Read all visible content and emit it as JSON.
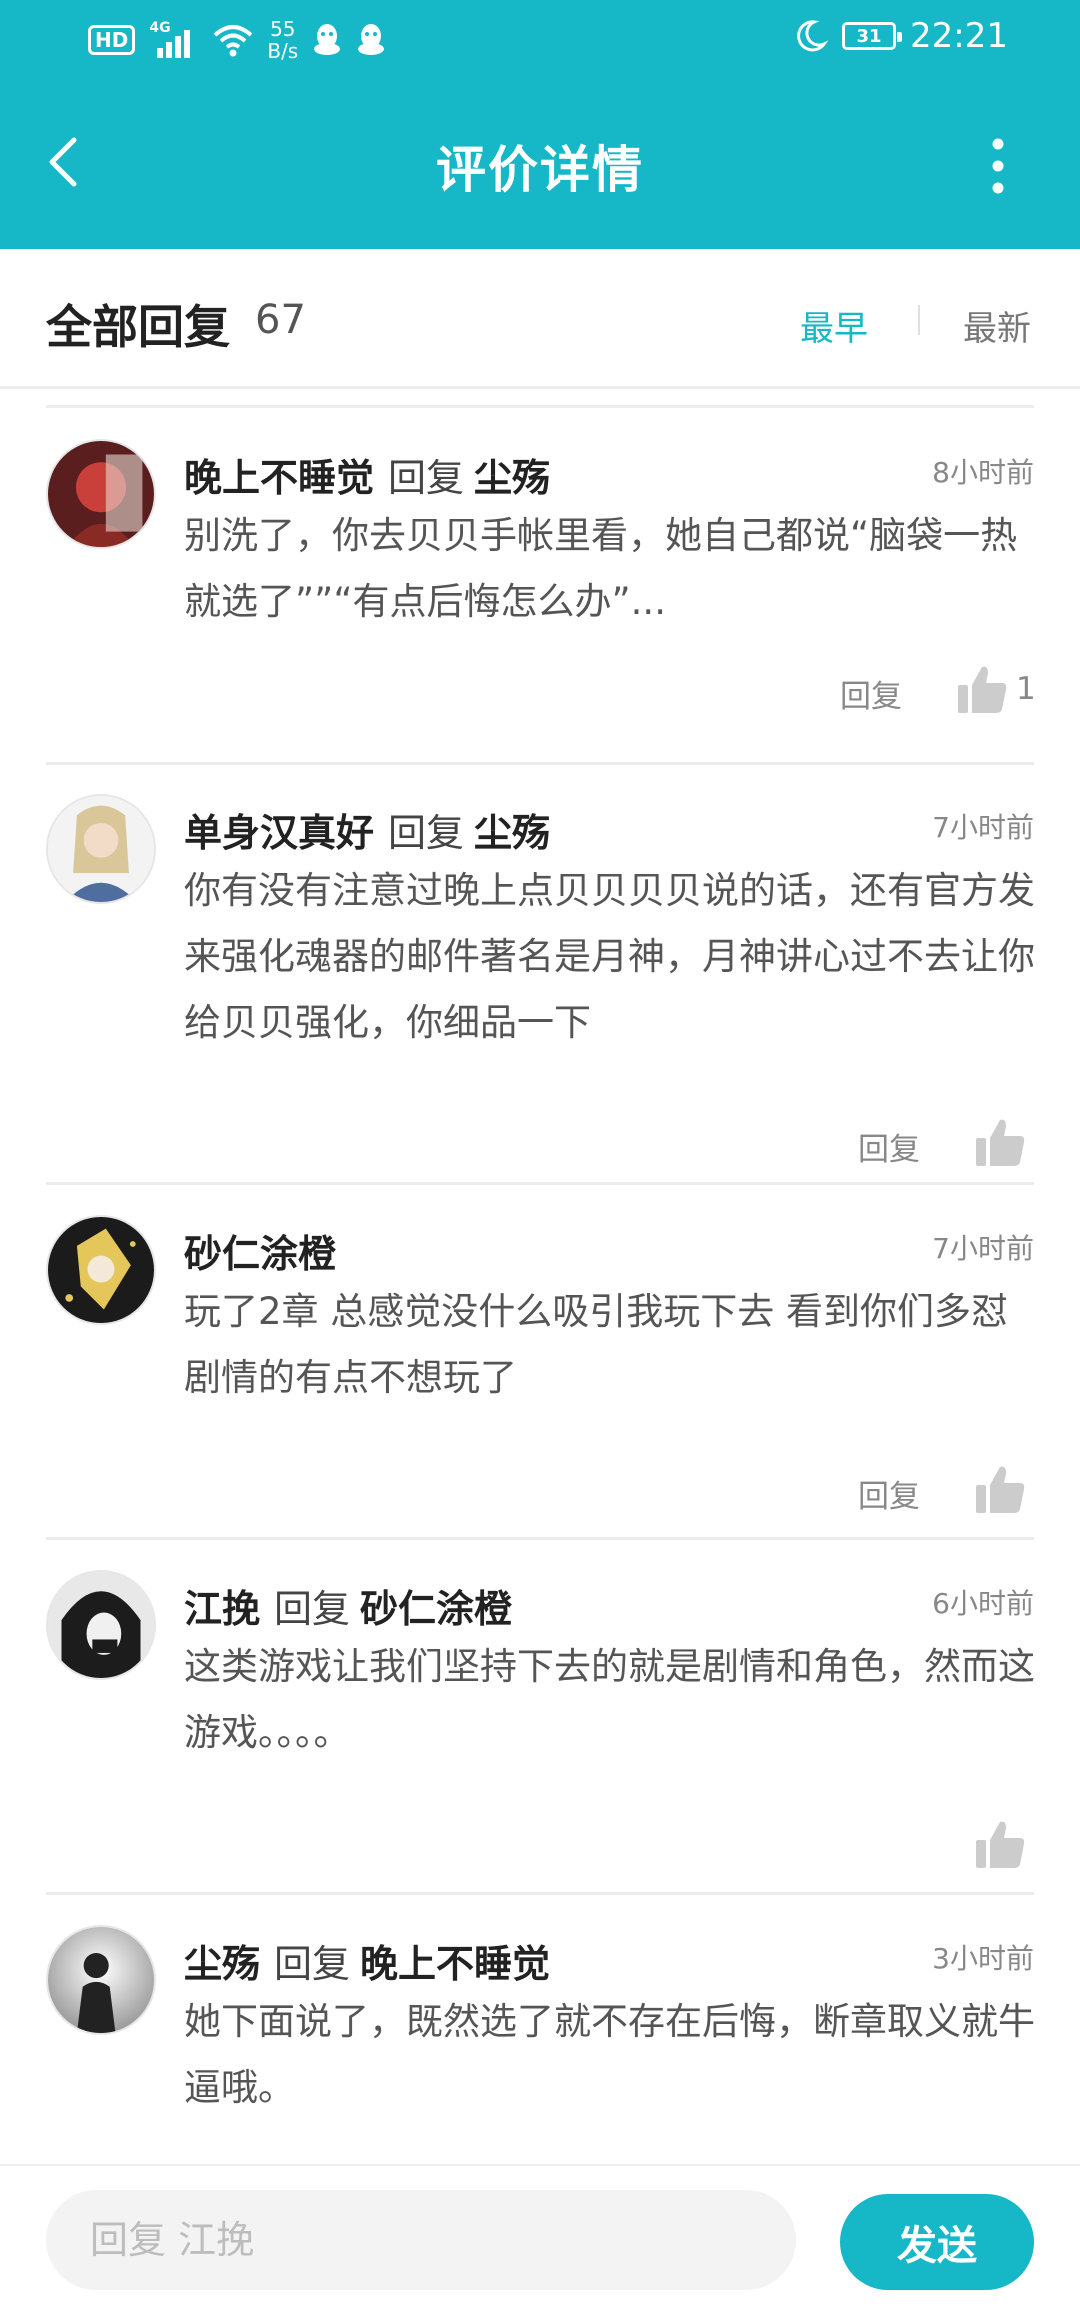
{
  "status_bar": {
    "hd": "HD",
    "network": "4G",
    "speed_value": "55",
    "speed_unit": "B/s",
    "battery": "31",
    "time": "22:21"
  },
  "header": {
    "title": "评价详情",
    "back_icon": "back-arrow-icon",
    "more_icon": "more-vertical-icon",
    "background": "#16b7c6"
  },
  "sort_bar": {
    "all_label": "全部回复",
    "count": "67",
    "earliest": "最早",
    "newest": "最新",
    "active_color": "#16b7c6"
  },
  "comments": [
    {
      "user": "晚上不睡觉",
      "reply_word": "回复",
      "target": "尘殇",
      "time": "8小时前",
      "text": "别洗了，你去贝贝手帐里看，她自己都说“脑袋一热就选了””“有点后悔怎么办”...",
      "reply_label": "回复",
      "likes": "1"
    },
    {
      "user": "单身汉真好",
      "reply_word": "回复",
      "target": "尘殇",
      "time": "7小时前",
      "text": "你有没有注意过晚上点贝贝贝贝说的话，还有官方发来强化魂器的邮件著名是月神，月神讲心过不去让你给贝贝强化，你细品一下",
      "reply_label": "回复"
    },
    {
      "user": "砂仁涂橙",
      "time": "7小时前",
      "text": "玩了2章 总感觉没什么吸引我玩下去  看到你们多怼剧情的有点不想玩了",
      "reply_label": "回复"
    },
    {
      "user": "江挽",
      "reply_word": "回复",
      "target": "砂仁涂橙",
      "time": "6小时前",
      "text": "这类游戏让我们坚持下去的就是剧情和角色，然而这游戏。。。。"
    },
    {
      "user": "尘殇",
      "reply_word": "回复",
      "target": "晚上不睡觉",
      "time": "3小时前",
      "text": "她下面说了，既然选了就不存在后悔，断章取义就牛逼哦。"
    }
  ],
  "footer": {
    "placeholder": "回复 江挽",
    "send_label": "发送"
  }
}
